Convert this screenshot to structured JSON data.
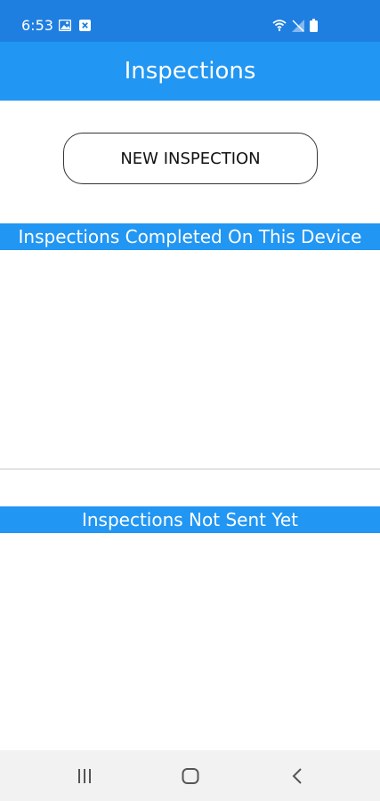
{
  "status_bar": {
    "time": "6:53",
    "left_icons": [
      "image-icon",
      "close-box-icon"
    ],
    "right_icons": [
      "wifi-icon",
      "signal-icon",
      "battery-icon"
    ]
  },
  "app_bar": {
    "title": "Inspections"
  },
  "actions": {
    "new_inspection_label": "NEW INSPECTION"
  },
  "sections": {
    "completed_title": "Inspections Completed On This Device",
    "not_sent_title": "Inspections Not Sent Yet"
  },
  "nav_bar": {
    "buttons": [
      "recent-apps-icon",
      "home-icon",
      "back-icon"
    ]
  },
  "colors": {
    "status_bar": "#1f7fe0",
    "primary": "#2196f3",
    "nav_bar": "#f2f2f2"
  }
}
